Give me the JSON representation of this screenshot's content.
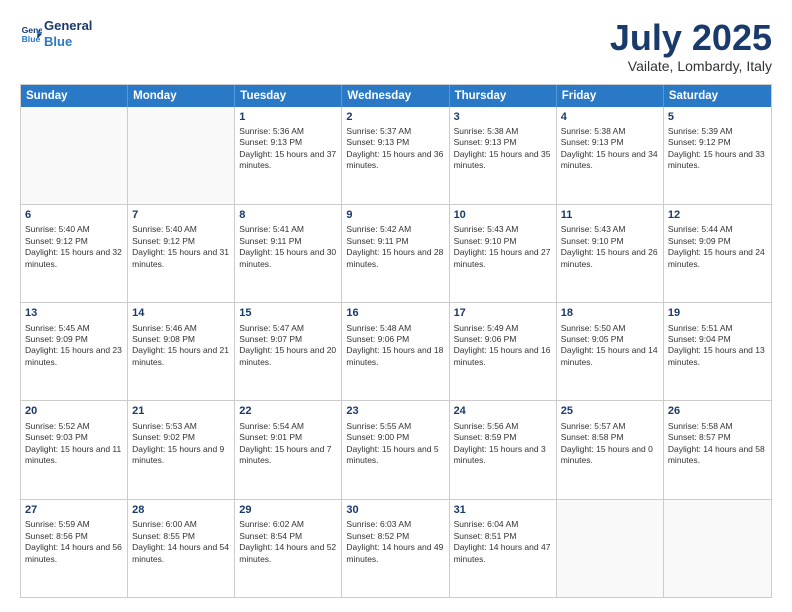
{
  "header": {
    "logo_line1": "General",
    "logo_line2": "Blue",
    "month_title": "July 2025",
    "location": "Vailate, Lombardy, Italy"
  },
  "weekdays": [
    "Sunday",
    "Monday",
    "Tuesday",
    "Wednesday",
    "Thursday",
    "Friday",
    "Saturday"
  ],
  "rows": [
    [
      {
        "day": "",
        "sunrise": "",
        "sunset": "",
        "daylight": "",
        "empty": true
      },
      {
        "day": "",
        "sunrise": "",
        "sunset": "",
        "daylight": "",
        "empty": true
      },
      {
        "day": "1",
        "sunrise": "Sunrise: 5:36 AM",
        "sunset": "Sunset: 9:13 PM",
        "daylight": "Daylight: 15 hours and 37 minutes."
      },
      {
        "day": "2",
        "sunrise": "Sunrise: 5:37 AM",
        "sunset": "Sunset: 9:13 PM",
        "daylight": "Daylight: 15 hours and 36 minutes."
      },
      {
        "day": "3",
        "sunrise": "Sunrise: 5:38 AM",
        "sunset": "Sunset: 9:13 PM",
        "daylight": "Daylight: 15 hours and 35 minutes."
      },
      {
        "day": "4",
        "sunrise": "Sunrise: 5:38 AM",
        "sunset": "Sunset: 9:13 PM",
        "daylight": "Daylight: 15 hours and 34 minutes."
      },
      {
        "day": "5",
        "sunrise": "Sunrise: 5:39 AM",
        "sunset": "Sunset: 9:12 PM",
        "daylight": "Daylight: 15 hours and 33 minutes."
      }
    ],
    [
      {
        "day": "6",
        "sunrise": "Sunrise: 5:40 AM",
        "sunset": "Sunset: 9:12 PM",
        "daylight": "Daylight: 15 hours and 32 minutes."
      },
      {
        "day": "7",
        "sunrise": "Sunrise: 5:40 AM",
        "sunset": "Sunset: 9:12 PM",
        "daylight": "Daylight: 15 hours and 31 minutes."
      },
      {
        "day": "8",
        "sunrise": "Sunrise: 5:41 AM",
        "sunset": "Sunset: 9:11 PM",
        "daylight": "Daylight: 15 hours and 30 minutes."
      },
      {
        "day": "9",
        "sunrise": "Sunrise: 5:42 AM",
        "sunset": "Sunset: 9:11 PM",
        "daylight": "Daylight: 15 hours and 28 minutes."
      },
      {
        "day": "10",
        "sunrise": "Sunrise: 5:43 AM",
        "sunset": "Sunset: 9:10 PM",
        "daylight": "Daylight: 15 hours and 27 minutes."
      },
      {
        "day": "11",
        "sunrise": "Sunrise: 5:43 AM",
        "sunset": "Sunset: 9:10 PM",
        "daylight": "Daylight: 15 hours and 26 minutes."
      },
      {
        "day": "12",
        "sunrise": "Sunrise: 5:44 AM",
        "sunset": "Sunset: 9:09 PM",
        "daylight": "Daylight: 15 hours and 24 minutes."
      }
    ],
    [
      {
        "day": "13",
        "sunrise": "Sunrise: 5:45 AM",
        "sunset": "Sunset: 9:09 PM",
        "daylight": "Daylight: 15 hours and 23 minutes."
      },
      {
        "day": "14",
        "sunrise": "Sunrise: 5:46 AM",
        "sunset": "Sunset: 9:08 PM",
        "daylight": "Daylight: 15 hours and 21 minutes."
      },
      {
        "day": "15",
        "sunrise": "Sunrise: 5:47 AM",
        "sunset": "Sunset: 9:07 PM",
        "daylight": "Daylight: 15 hours and 20 minutes."
      },
      {
        "day": "16",
        "sunrise": "Sunrise: 5:48 AM",
        "sunset": "Sunset: 9:06 PM",
        "daylight": "Daylight: 15 hours and 18 minutes."
      },
      {
        "day": "17",
        "sunrise": "Sunrise: 5:49 AM",
        "sunset": "Sunset: 9:06 PM",
        "daylight": "Daylight: 15 hours and 16 minutes."
      },
      {
        "day": "18",
        "sunrise": "Sunrise: 5:50 AM",
        "sunset": "Sunset: 9:05 PM",
        "daylight": "Daylight: 15 hours and 14 minutes."
      },
      {
        "day": "19",
        "sunrise": "Sunrise: 5:51 AM",
        "sunset": "Sunset: 9:04 PM",
        "daylight": "Daylight: 15 hours and 13 minutes."
      }
    ],
    [
      {
        "day": "20",
        "sunrise": "Sunrise: 5:52 AM",
        "sunset": "Sunset: 9:03 PM",
        "daylight": "Daylight: 15 hours and 11 minutes."
      },
      {
        "day": "21",
        "sunrise": "Sunrise: 5:53 AM",
        "sunset": "Sunset: 9:02 PM",
        "daylight": "Daylight: 15 hours and 9 minutes."
      },
      {
        "day": "22",
        "sunrise": "Sunrise: 5:54 AM",
        "sunset": "Sunset: 9:01 PM",
        "daylight": "Daylight: 15 hours and 7 minutes."
      },
      {
        "day": "23",
        "sunrise": "Sunrise: 5:55 AM",
        "sunset": "Sunset: 9:00 PM",
        "daylight": "Daylight: 15 hours and 5 minutes."
      },
      {
        "day": "24",
        "sunrise": "Sunrise: 5:56 AM",
        "sunset": "Sunset: 8:59 PM",
        "daylight": "Daylight: 15 hours and 3 minutes."
      },
      {
        "day": "25",
        "sunrise": "Sunrise: 5:57 AM",
        "sunset": "Sunset: 8:58 PM",
        "daylight": "Daylight: 15 hours and 0 minutes."
      },
      {
        "day": "26",
        "sunrise": "Sunrise: 5:58 AM",
        "sunset": "Sunset: 8:57 PM",
        "daylight": "Daylight: 14 hours and 58 minutes."
      }
    ],
    [
      {
        "day": "27",
        "sunrise": "Sunrise: 5:59 AM",
        "sunset": "Sunset: 8:56 PM",
        "daylight": "Daylight: 14 hours and 56 minutes."
      },
      {
        "day": "28",
        "sunrise": "Sunrise: 6:00 AM",
        "sunset": "Sunset: 8:55 PM",
        "daylight": "Daylight: 14 hours and 54 minutes."
      },
      {
        "day": "29",
        "sunrise": "Sunrise: 6:02 AM",
        "sunset": "Sunset: 8:54 PM",
        "daylight": "Daylight: 14 hours and 52 minutes."
      },
      {
        "day": "30",
        "sunrise": "Sunrise: 6:03 AM",
        "sunset": "Sunset: 8:52 PM",
        "daylight": "Daylight: 14 hours and 49 minutes."
      },
      {
        "day": "31",
        "sunrise": "Sunrise: 6:04 AM",
        "sunset": "Sunset: 8:51 PM",
        "daylight": "Daylight: 14 hours and 47 minutes."
      },
      {
        "day": "",
        "sunrise": "",
        "sunset": "",
        "daylight": "",
        "empty": true
      },
      {
        "day": "",
        "sunrise": "",
        "sunset": "",
        "daylight": "",
        "empty": true
      }
    ]
  ]
}
